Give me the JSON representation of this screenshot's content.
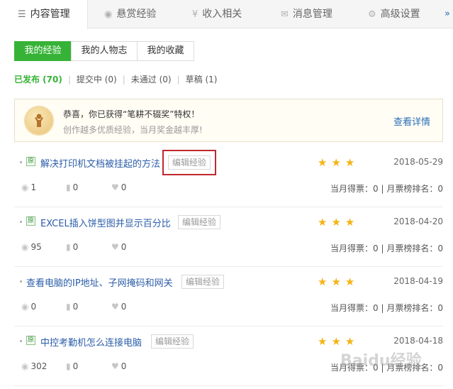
{
  "top_tabs": [
    {
      "label": "内容管理",
      "icon": "list-icon",
      "active": true
    },
    {
      "label": "悬赏经验",
      "icon": "coin-icon",
      "active": false
    },
    {
      "label": "收入相关",
      "icon": "yen-icon",
      "active": false
    },
    {
      "label": "消息管理",
      "icon": "mail-icon",
      "active": false
    },
    {
      "label": "高级设置",
      "icon": "gear-icon",
      "active": false
    }
  ],
  "more_label": "»",
  "sub_tabs": [
    {
      "label": "我的经验",
      "active": true
    },
    {
      "label": "我的人物志",
      "active": false
    },
    {
      "label": "我的收藏",
      "active": false
    }
  ],
  "filters": [
    {
      "label": "已发布 (70)",
      "active": true
    },
    {
      "label": "提交中 (0)",
      "active": false
    },
    {
      "label": "未通过 (0)",
      "active": false
    },
    {
      "label": "草稿 (1)",
      "active": false
    }
  ],
  "banner": {
    "title": "恭喜，你已获得“笔耕不辍奖”特权！",
    "subtitle": "创作越多优质经验，当月奖金越丰厚!",
    "link": "查看详情"
  },
  "articles": [
    {
      "original": true,
      "title": "解决打印机文档被挂起的方法",
      "edit_label": "编辑经验",
      "stars": 3,
      "date": "2018-05-29",
      "views": "1",
      "votes_count": "0",
      "likes": "0",
      "monthly": "当月得票：0 | 月票榜排名：0"
    },
    {
      "original": true,
      "title": "EXCEL插入饼型图并显示百分比",
      "edit_label": "编辑经验",
      "stars": 3,
      "date": "2018-04-20",
      "views": "95",
      "votes_count": "0",
      "likes": "0",
      "monthly": "当月得票：0 | 月票榜排名：0"
    },
    {
      "original": false,
      "title": "查看电脑的IP地址、子网掩码和网关",
      "edit_label": "编辑经验",
      "stars": 3,
      "date": "2018-04-19",
      "views": "0",
      "votes_count": "0",
      "likes": "0",
      "monthly": "当月得票：0 | 月票榜排名：0"
    },
    {
      "original": true,
      "title": "中控考勤机怎么连接电脑",
      "edit_label": "编辑经验",
      "stars": 3,
      "date": "2018-04-18",
      "views": "302",
      "votes_count": "0",
      "likes": "0",
      "monthly": "当月得票：0 | 月票榜排名：0"
    }
  ],
  "original_badge": "原",
  "watermark": "Baidu经验",
  "colors": {
    "accent_green": "#36b337",
    "link_blue": "#2b5da8",
    "star": "#f5b313",
    "highlight_red": "#c0282e"
  }
}
